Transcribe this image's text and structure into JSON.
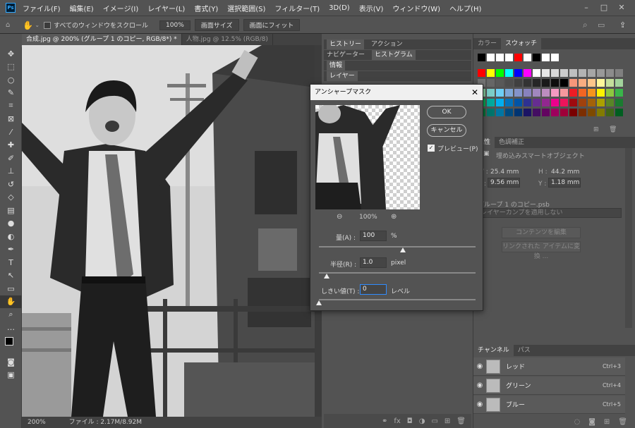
{
  "menu": [
    "ファイル(F)",
    "編集(E)",
    "イメージ(I)",
    "レイヤー(L)",
    "書式(Y)",
    "選択範囲(S)",
    "フィルター(T)",
    "3D(D)",
    "表示(V)",
    "ウィンドウ(W)",
    "ヘルプ(H)"
  ],
  "app_logo": "Ps",
  "options": {
    "scroll_all": "すべてのウィンドウをスクロール",
    "zoom": "100%",
    "fit_screen_size": "画面サイズ",
    "fit_screen": "画面にフィット"
  },
  "doc_tabs": [
    "合成.jpg @ 200% (グループ 1 のコピー, RGB/8*) *",
    "人物.jpg @ 12.5% (RGB/8)"
  ],
  "status": {
    "zoom": "200%",
    "file": "ファイル : 2.17M/8.92M"
  },
  "mid_panels": {
    "history_tab": "ヒストリー",
    "action_tab": "アクション",
    "navigator_tab": "ナビゲーター",
    "histogram_tab": "ヒストグラム",
    "info_tab": "情報",
    "layers_tab": "レイヤー"
  },
  "right_panels": {
    "color_tab": "カラー",
    "swatches_tab": "スウォッチ",
    "props_tab": "属性",
    "adjust_tab": "色調補正",
    "smart_object": "埋め込みスマートオブジェクト",
    "w_label": "W :",
    "w_value": "25.4 mm",
    "h_label": "H :",
    "h_value": "44.2 mm",
    "x_label": "X :",
    "x_value": "9.56 mm",
    "y_label": "Y :",
    "y_value": "1.18 mm",
    "psb_name": "グループ 1 のコピー.psb",
    "layer_comp": "レイヤーカンプを適用しない",
    "edit_contents": "コンテンツを編集",
    "convert_linked": "リンクされた アイテムに変換 ..."
  },
  "channels": {
    "tab": "チャンネル",
    "paths_tab": "パス",
    "rows": [
      {
        "name": "レッド",
        "shortcut": "Ctrl+3"
      },
      {
        "name": "グリーン",
        "shortcut": "Ctrl+4"
      },
      {
        "name": "ブルー",
        "shortcut": "Ctrl+5"
      }
    ]
  },
  "dialog": {
    "title": "アンシャープマスク",
    "ok": "OK",
    "cancel": "キャンセル",
    "preview": "プレビュー(P)",
    "zoom": "100%",
    "amount_label": "量(A) :",
    "amount_value": "100",
    "amount_unit": "%",
    "radius_label": "半径(R) :",
    "radius_value": "1.0",
    "radius_unit": "pixel",
    "threshold_label": "しきい値(T) :",
    "threshold_value": "0",
    "threshold_unit": "レベル"
  },
  "colors": {
    "accent": "#2f8cff",
    "swatches_row1": [
      "#000000",
      "#ffffff",
      "#ffffff",
      "#ffffff",
      "#ff0000",
      "#ffffff",
      "#000000",
      "#ffffff",
      "#ffffff"
    ],
    "swatches_grid": [
      [
        "#ff0000",
        "#ffff00",
        "#00ff00",
        "#00ffff",
        "#0000ff",
        "#ff00ff",
        "#ffffff",
        "#e6e6e6",
        "#d9d9d9",
        "#cccccc",
        "#bfbfbf",
        "#b3b3b3",
        "#a6a6a6",
        "#999999",
        "#8c8c8c",
        "#808080"
      ],
      [
        "#737373",
        "#666666",
        "#595959",
        "#4d4d4d",
        "#404040",
        "#333333",
        "#262626",
        "#1a1a1a",
        "#0d0d0d",
        "#000000",
        "#f7977a",
        "#f9ad81",
        "#fdc68a",
        "#fff79a",
        "#c4df9b",
        "#a2d39c"
      ],
      [
        "#82ca9d",
        "#7bcdc8",
        "#6ecff6",
        "#7ea7d8",
        "#8493ca",
        "#8882be",
        "#a187be",
        "#bc8dbf",
        "#f49ac2",
        "#f6989d",
        "#ed1c24",
        "#f26522",
        "#f7941d",
        "#fff200",
        "#8dc73f",
        "#39b54a"
      ],
      [
        "#00a651",
        "#00a99d",
        "#00aeef",
        "#0072bc",
        "#0054a6",
        "#2e3192",
        "#662d91",
        "#92278f",
        "#ec008c",
        "#ed145b",
        "#9e0b0f",
        "#a0410d",
        "#a36209",
        "#aba000",
        "#598527",
        "#1a7b30"
      ],
      [
        "#007236",
        "#00746b",
        "#0076a3",
        "#004b80",
        "#003471",
        "#1b1464",
        "#440e62",
        "#630460",
        "#9e005d",
        "#9e0039",
        "#790000",
        "#7b2e00",
        "#7d4900",
        "#827b00",
        "#406618",
        "#005e20"
      ]
    ]
  }
}
